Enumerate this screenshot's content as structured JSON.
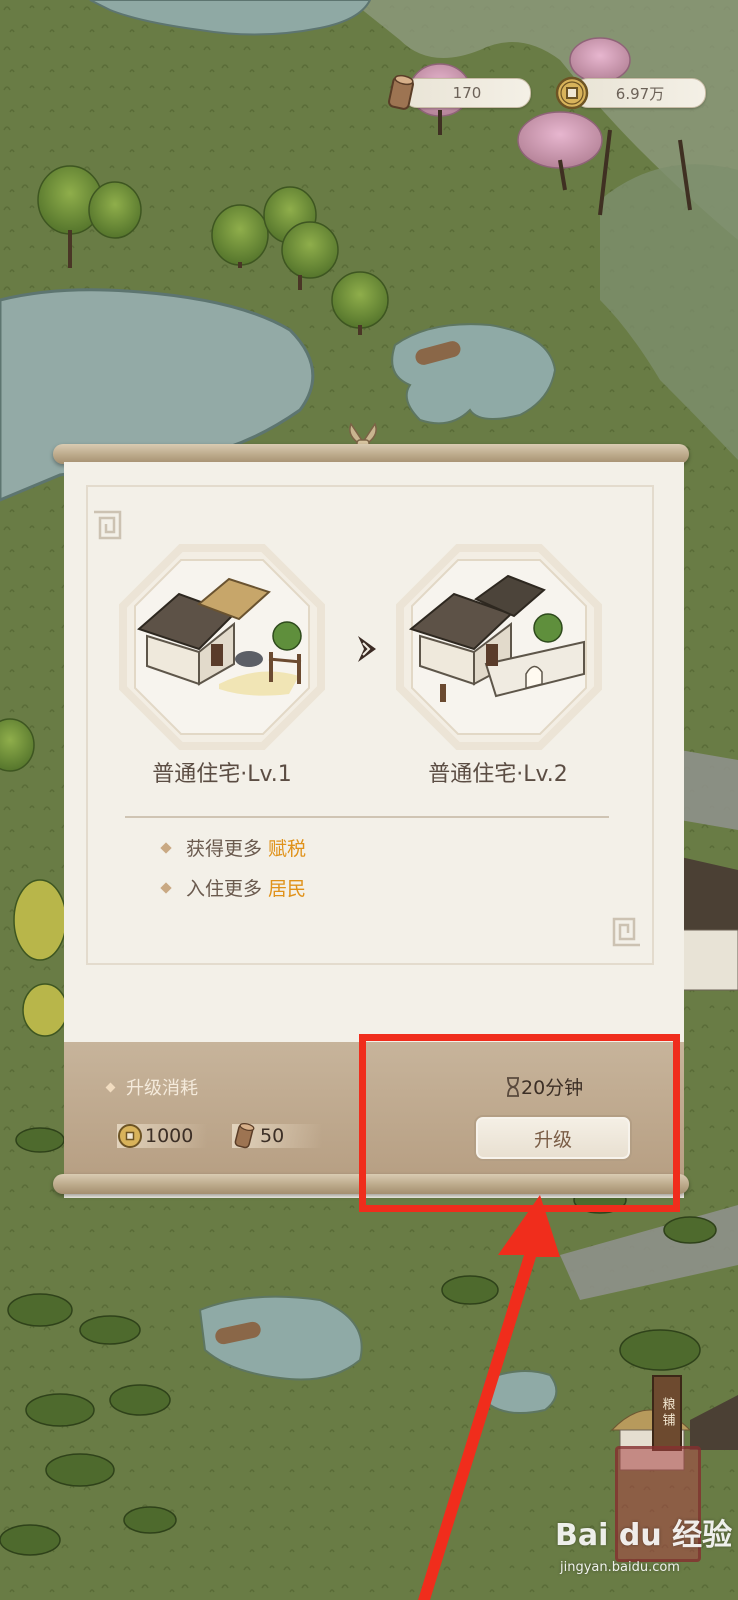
{
  "resources": {
    "wood": "170",
    "coins": "6.97万"
  },
  "upgrade_panel": {
    "current": {
      "name": "普通住宅",
      "level": "·Lv.1"
    },
    "next": {
      "name": "普通住宅",
      "level": "·Lv.2"
    },
    "perks": [
      {
        "prefix": "获得更多",
        "highlight": "赋税"
      },
      {
        "prefix": "入住更多",
        "highlight": "居民"
      }
    ],
    "cost": {
      "title": "升级消耗",
      "coins": "1000",
      "wood": "50"
    },
    "time": "20分钟",
    "button_label": "升级"
  },
  "map": {
    "shop_sign": "粮铺"
  },
  "watermark": {
    "logo": "Bai du 经验",
    "url": "jingyan.baidu.com"
  },
  "colors": {
    "highlight_accent": "#e0921a",
    "annotation_red": "#f02d1c"
  }
}
